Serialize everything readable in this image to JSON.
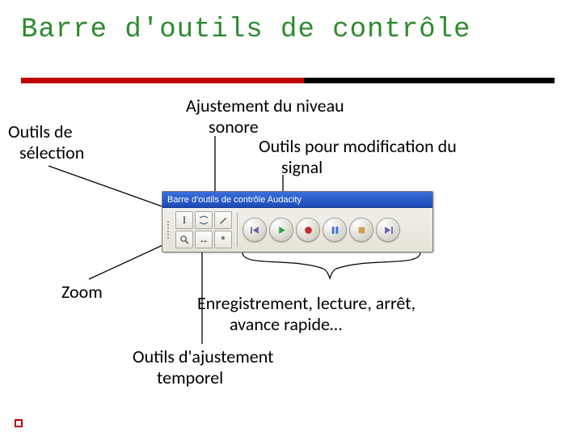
{
  "title": "Barre d'outils de contrôle",
  "labels": {
    "outils_selection_l1": "Outils de",
    "outils_selection_l2": "sélection",
    "ajustement_l1": "Ajustement du niveau",
    "ajustement_l2": "sonore",
    "modif_signal_l1": "Outils pour modification du",
    "modif_signal_l2": "signal",
    "zoom": "Zoom",
    "enreg_l1": "Enregistrement, lecture, arrêt,",
    "enreg_l2": "avance rapide…",
    "temporel_l1": "Outils d'ajustement",
    "temporel_l2": "temporel"
  },
  "toolbar": {
    "title": "Barre d'outils de contrôle Audacity",
    "tools": {
      "selection": "I",
      "envelope": "env",
      "draw": "draw",
      "zoom": "zoom",
      "timeshift": "↔",
      "multi": "*"
    },
    "transport": {
      "skip_start": "skip-start",
      "play": "play",
      "record": "record",
      "pause": "pause",
      "stop": "stop",
      "skip_end": "skip-end"
    }
  }
}
